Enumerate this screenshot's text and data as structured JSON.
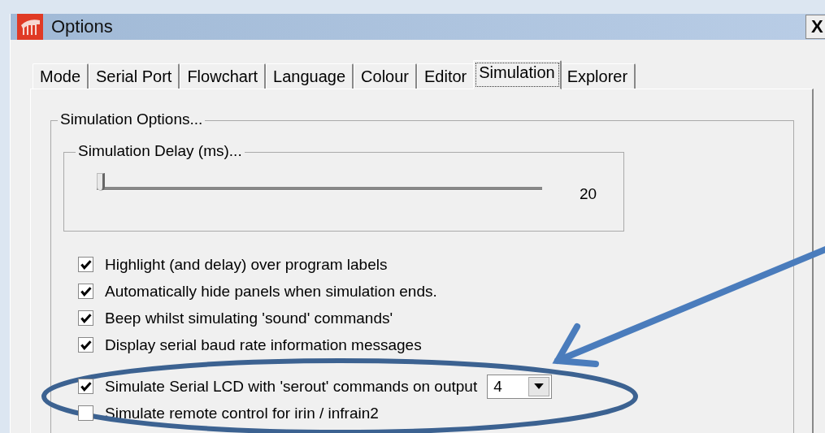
{
  "window": {
    "title": "Options",
    "close_label": "X"
  },
  "tabs": [
    {
      "label": "Mode",
      "selected": false
    },
    {
      "label": "Serial Port",
      "selected": false
    },
    {
      "label": "Flowchart",
      "selected": false
    },
    {
      "label": "Language",
      "selected": false
    },
    {
      "label": "Colour",
      "selected": false
    },
    {
      "label": "Editor",
      "selected": false
    },
    {
      "label": "Simulation",
      "selected": true
    },
    {
      "label": "Explorer",
      "selected": false
    }
  ],
  "simulation_options": {
    "title": "Simulation Options...",
    "delay": {
      "title": "Simulation Delay (ms)...",
      "level": 0,
      "reading": "20"
    },
    "options": [
      {
        "kind": "checkbox",
        "label": "Highlight (and delay) over program labels",
        "checked": true
      },
      {
        "kind": "checkbox",
        "label": "Automatically hide panels when simulation ends.",
        "checked": true
      },
      {
        "kind": "checkbox",
        "label": "Beep whilst simulating 'sound' commands'",
        "checked": true
      },
      {
        "kind": "checkbox",
        "label": "Display serial baud rate information messages",
        "checked": true
      },
      {
        "kind": "dropdown",
        "label": "Simulate Serial LCD with 'serout' commands on output",
        "checked": true,
        "value": "4"
      },
      {
        "kind": "checkbox",
        "label": "Simulate remote control for irin / infrain2",
        "checked": false
      }
    ]
  }
}
